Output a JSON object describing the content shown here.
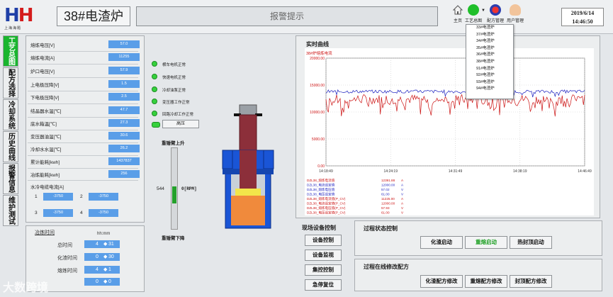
{
  "header": {
    "logo_text": "上海海题",
    "furnace_title": "38#电渣炉",
    "alarm_label": "报警提示",
    "icons": [
      {
        "name": "home-icon",
        "label": "主页"
      },
      {
        "name": "process-icon",
        "label": "工艺总图"
      },
      {
        "name": "recipe-icon",
        "label": "配方管理"
      },
      {
        "name": "user-icon",
        "label": "用户管理"
      }
    ],
    "date": "2019/6/14",
    "time": "14:46:50"
  },
  "sidenav": [
    {
      "label": "工艺总图",
      "active": true
    },
    {
      "label": "配方选择",
      "active": false
    },
    {
      "label": "冷却系统",
      "active": false
    },
    {
      "label": "历史曲线",
      "active": false
    },
    {
      "label": "报警信息",
      "active": false
    },
    {
      "label": "维护测试",
      "active": false
    }
  ],
  "params": [
    {
      "label": "熔炼电压[V]",
      "value": "57.0"
    },
    {
      "label": "熔炼电流[A]",
      "value": "11255"
    },
    {
      "label": "炉口电压[V]",
      "value": "57.9"
    },
    {
      "label": "上电极压降[V]",
      "value": "1.5"
    },
    {
      "label": "下电极压降[V]",
      "value": "2.5"
    },
    {
      "label": "结晶器水温[℃]",
      "value": "47.7"
    },
    {
      "label": "底水箱温[℃]",
      "value": "27.3"
    },
    {
      "label": "变压器油温[℃]",
      "value": "30.6"
    },
    {
      "label": "冷却水水温[℃]",
      "value": "26.2"
    },
    {
      "label": "累计能耗[kwh]",
      "value": "1437837"
    },
    {
      "label": "冶炼能耗[kwh]",
      "value": "256"
    }
  ],
  "cooling": {
    "title": "水冷电缆电流[A]",
    "items": [
      {
        "idx": "1",
        "value": "-3750"
      },
      {
        "idx": "2",
        "value": "-3750"
      },
      {
        "idx": "3",
        "value": "-3750"
      },
      {
        "idx": "4",
        "value": "-3750"
      }
    ]
  },
  "times": {
    "title": "冶炼时间",
    "unit": "hh:mm",
    "rows": [
      {
        "label": "总时间",
        "h": "4",
        "m": "31"
      },
      {
        "label": "化渣时间",
        "h": "0",
        "m": "30"
      },
      {
        "label": "熔炼时间",
        "h": "4",
        "m": "1"
      },
      {
        "label": "",
        "h": "0",
        "m": "0"
      }
    ]
  },
  "status_lights": [
    {
      "label": "横车电机正常",
      "on": true
    },
    {
      "label": "快速电机正常",
      "on": true
    },
    {
      "label": "冷却油泵正常",
      "on": true
    },
    {
      "label": "变压器工作正常",
      "on": true
    },
    {
      "label": "回路冷却工作正常",
      "on": true
    },
    {
      "label": "高压",
      "on": true
    }
  ],
  "arm": {
    "up_label": "重锤臂上升",
    "down_label": "重锤臂下降",
    "position": "544",
    "speed": "0[RPM]"
  },
  "chart_data": {
    "type": "line",
    "title": "实时曲线",
    "subtitle": "38#炉熔炼电流",
    "yticks": [
      "20000.00",
      "15000.00",
      "10000.00",
      "5000.00",
      "0.00"
    ],
    "ylim": [
      0,
      20000
    ],
    "xticks": [
      "14:18:49",
      "14:24:19",
      "14:31:49",
      "14:38:19",
      "14:46:49"
    ],
    "series": [
      {
        "name": "DZL38_熔炼电流值",
        "color": "#cc1111",
        "mean": 12391.88
      },
      {
        "name": "DZL38_熔炼电流设定值",
        "color": "#1a1fbf",
        "mean": 13800
      }
    ],
    "legend": [
      {
        "name": "DZL38_熔炼电流值",
        "value": "12391.88",
        "unit": "A",
        "color": "#cc1111"
      },
      {
        "name": "DZL38_电流设定值",
        "value": "12000.00",
        "unit": "A",
        "color": "#1a1fbf"
      },
      {
        "name": "DZL38_熔炼电压值",
        "value": "57.02",
        "unit": "V",
        "color": "#1a1fbf"
      },
      {
        "name": "DZL38_电压设定值",
        "value": "61.00",
        "unit": "V",
        "color": "#1a1fbf"
      },
      {
        "name": "DZL38_熔炼电流值(P_CV)",
        "value": "11225.00",
        "unit": "A",
        "color": "#cc1111"
      },
      {
        "name": "DZL38_电流设定值(P_CV)",
        "value": "12000.00",
        "unit": "A",
        "color": "#cc1111"
      },
      {
        "name": "DZL38_熔炼电压值(P_CV)",
        "value": "57.93",
        "unit": "V",
        "color": "#cc1111"
      },
      {
        "name": "DZL38_电压设定值(P_CV)",
        "value": "61.00",
        "unit": "V",
        "color": "#cc1111"
      }
    ]
  },
  "onsite": {
    "title": "现场设备控制",
    "buttons": [
      "设备控制",
      "设备监视",
      "集控控制",
      "急停复位"
    ]
  },
  "process": {
    "title": "过程状态控制",
    "buttons": [
      "化渣启动",
      "重熔启动",
      "热封顶启动"
    ]
  },
  "recipe": {
    "title": "过程在线修改配方",
    "buttons": [
      "化渣配方修改",
      "重熔配方修改",
      "封顶配方修改"
    ]
  },
  "dropdown": [
    "33#电渣炉",
    "37#电渣炉",
    "34#电渣炉",
    "35#电渣炉",
    "36#电渣炉",
    "38#电渣炉",
    "91#电渣炉",
    "92#电渣炉",
    "93#电渣炉",
    "94#电渣炉"
  ],
  "watermark": "大数跨境"
}
